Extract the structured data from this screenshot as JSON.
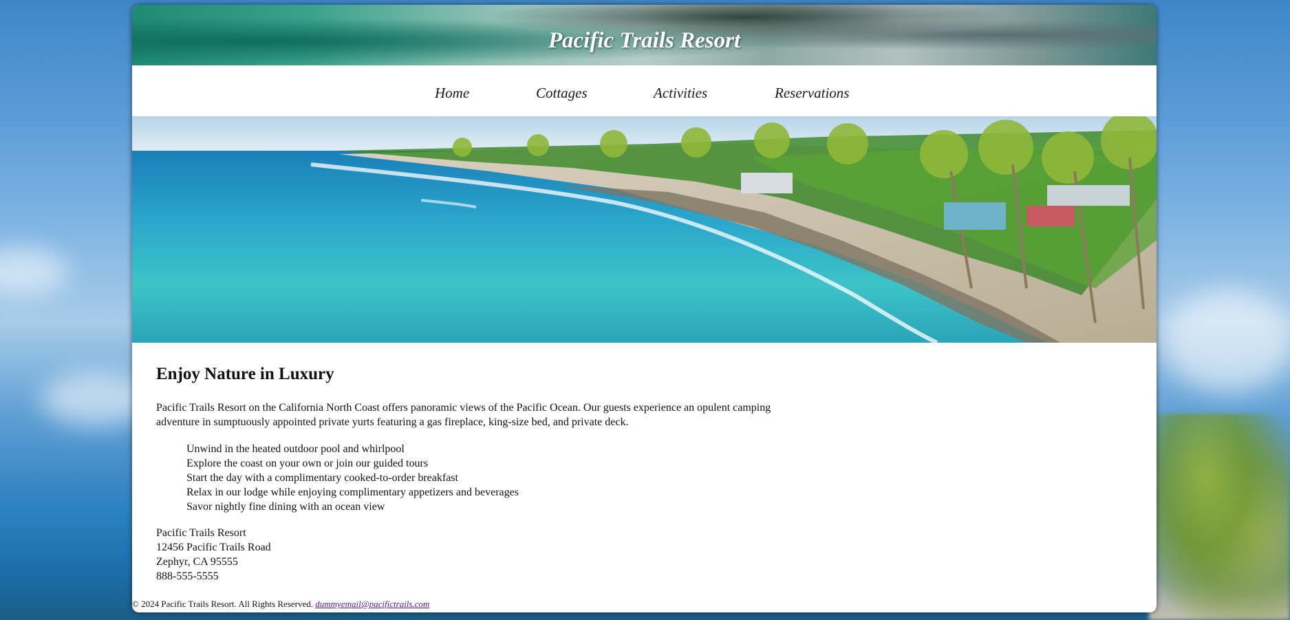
{
  "header": {
    "title": "Pacific Trails Resort"
  },
  "nav": {
    "items": [
      {
        "label": "Home"
      },
      {
        "label": "Cottages"
      },
      {
        "label": "Activities"
      },
      {
        "label": "Reservations"
      }
    ]
  },
  "hero": {
    "image": "tropical-beach-palms-image"
  },
  "main": {
    "heading": "Enjoy Nature in Luxury",
    "intro": "Pacific Trails Resort on the California North Coast offers panoramic views of the Pacific Ocean. Our guests experience an opulent camping adventure in sumptuously appointed private yurts featuring a gas fireplace, king-size bed, and private deck.",
    "features": [
      "Unwind in the heated outdoor pool and whirlpool",
      "Explore the coast on your own or join our guided tours",
      "Start the day with a complimentary cooked-to-order breakfast",
      "Relax in our lodge while enjoying complimentary appetizers and beverages",
      "Savor nightly fine dining with an ocean view"
    ],
    "address": {
      "name": "Pacific Trails Resort",
      "street": "12456 Pacific Trails Road",
      "city": "Zephyr, CA 95555",
      "phone": "888-555-5555"
    }
  },
  "footer": {
    "copyright": "© 2024 Pacific Trails Resort. All Rights Reserved.",
    "email": "dummyemail@pacifictrails.com"
  },
  "colors": {
    "link_visited": "#551a8b",
    "header_teal": "#1f8a73",
    "text": "#111111"
  }
}
